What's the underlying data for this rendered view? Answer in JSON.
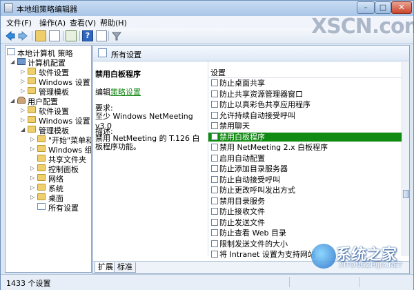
{
  "window": {
    "title": "本地组策略编辑器"
  },
  "menu": [
    "文件(F)",
    "操作(A)",
    "查看(V)",
    "帮助(H)"
  ],
  "tree": [
    {
      "label": "本地计算机 策略",
      "icon": "book-icon"
    },
    {
      "label": "计算机配置",
      "icon": "computer-icon"
    },
    {
      "label": "软件设置",
      "icon": "folder-icon"
    },
    {
      "label": "Windows 设置",
      "icon": "folder-icon"
    },
    {
      "label": "管理模板",
      "icon": "folder-icon"
    },
    {
      "label": "用户配置",
      "icon": "user-icon"
    },
    {
      "label": "软件设置",
      "icon": "folder-icon"
    },
    {
      "label": "Windows 设置",
      "icon": "folder-icon"
    },
    {
      "label": "管理模板",
      "icon": "folder-icon"
    },
    {
      "label": "\"开始\"菜单和",
      "icon": "folder-icon"
    },
    {
      "label": "Windows 组件",
      "icon": "folder-icon"
    },
    {
      "label": "共享文件夹",
      "icon": "folder-icon"
    },
    {
      "label": "控制面板",
      "icon": "folder-icon"
    },
    {
      "label": "网络",
      "icon": "folder-icon"
    },
    {
      "label": "系统",
      "icon": "folder-icon"
    },
    {
      "label": "桌面",
      "icon": "folder-icon"
    },
    {
      "label": "所有设置",
      "icon": "settings-icon"
    }
  ],
  "right": {
    "header": "所有设置",
    "desc": {
      "title": "禁用白板程序",
      "edit_prefix": "编辑",
      "edit_link": "策略设置",
      "req_label": "要求:",
      "req_value": "至少 Windows NetMeeting v3.0",
      "desc_label": "描述:",
      "desc_text": "禁用 NetMeeting 的 T.126 白板程序功能。"
    },
    "list_header": "设置",
    "settings": [
      "防止桌面共享",
      "防止共享资源管理器窗口",
      "防止以真彩色共享应用程序",
      "允许持续自动接受呼叫",
      "禁用聊天",
      "禁用白板程序",
      "禁用 NetMeeting 2.x 白板程序",
      "启用自动配置",
      "防止添加目录服务器",
      "防止自动接受呼叫",
      "防止更改呼叫发出方式",
      "禁用目录服务",
      "防止接收文件",
      "防止发送文件",
      "防止查看 Web 目录",
      "限制发送文件的大小",
      "将 Intranet 设置为支持网站"
    ],
    "selected_index": 5,
    "tabs": [
      "扩展",
      "标准"
    ]
  },
  "status": {
    "text": "1433 个设置"
  },
  "watermark": {
    "top": "XSCN.com",
    "logo_cn": "系统之家",
    "logo_en": "XITONGZHIJIA.NET"
  }
}
